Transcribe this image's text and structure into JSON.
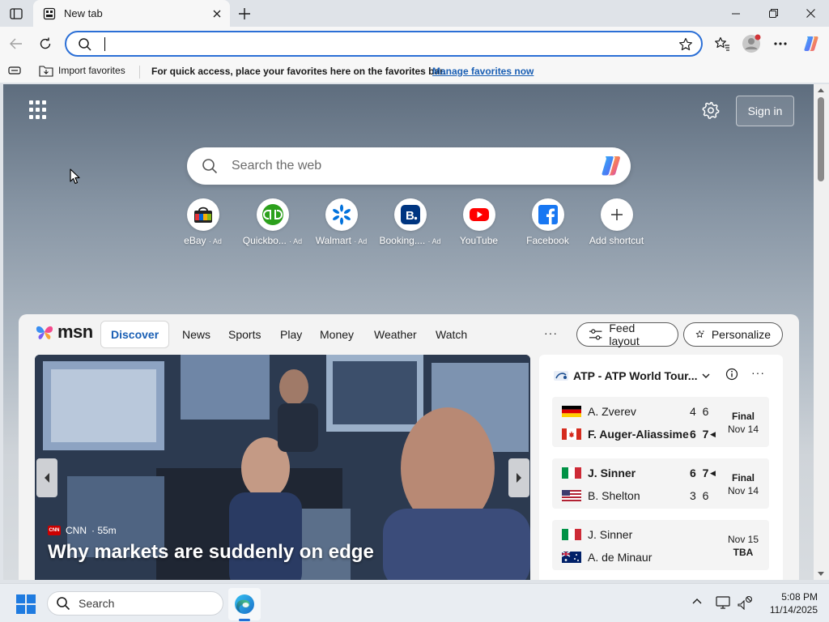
{
  "browser": {
    "tab_title": "New tab",
    "address_value": "",
    "favorites_bar": {
      "import_label": "Import favorites",
      "message": "For quick access, place your favorites here on the favorites bar.",
      "manage_link": "Manage favorites now"
    }
  },
  "newtab": {
    "signin_label": "Sign in",
    "search_placeholder": "Search the web",
    "shortcuts": [
      {
        "label": "eBay",
        "ad": "· Ad",
        "icon": "ebay-icon"
      },
      {
        "label": "Quickbo...",
        "ad": "· Ad",
        "icon": "quickbooks-icon"
      },
      {
        "label": "Walmart",
        "ad": "· Ad",
        "icon": "walmart-icon"
      },
      {
        "label": "Booking....",
        "ad": "· Ad",
        "icon": "booking-icon"
      },
      {
        "label": "YouTube",
        "ad": "",
        "icon": "youtube-icon"
      },
      {
        "label": "Facebook",
        "ad": "",
        "icon": "facebook-icon"
      },
      {
        "label": "Add shortcut",
        "ad": "",
        "icon": "plus-icon"
      }
    ]
  },
  "feed": {
    "logo_text": "msn",
    "nav": [
      "Discover",
      "News",
      "Sports",
      "Play",
      "Money",
      "Weather",
      "Watch"
    ],
    "more_label": "···",
    "feed_layout_label": "Feed layout",
    "personalize_label": "Personalize",
    "hero": {
      "source": "CNN",
      "time": "· 55m",
      "badge": "CNN",
      "title": "Why markets are suddenly on edge"
    },
    "sports": {
      "title": "ATP - ATP World Tour...",
      "matches": [
        {
          "p1": {
            "name": "A. Zverev",
            "score": "4 6",
            "win": false,
            "flag": "germany"
          },
          "p2": {
            "name": "F. Auger-Aliassime",
            "score": "6 7",
            "win": true,
            "flag": "canada"
          },
          "status": "Final",
          "date": "Nov 14"
        },
        {
          "p1": {
            "name": "J. Sinner",
            "score": "6 7",
            "win": true,
            "flag": "italy"
          },
          "p2": {
            "name": "B. Shelton",
            "score": "3 6",
            "win": false,
            "flag": "usa"
          },
          "status": "Final",
          "date": "Nov 14"
        },
        {
          "p1": {
            "name": "J. Sinner",
            "score": "",
            "win": false,
            "flag": "italy"
          },
          "p2": {
            "name": "A. de Minaur",
            "score": "",
            "win": false,
            "flag": "australia"
          },
          "status": "TBA",
          "date": "Nov 15"
        }
      ]
    }
  },
  "taskbar": {
    "search_label": "Search",
    "time": "5:08 PM",
    "date": "11/14/2025"
  },
  "colors": {
    "accent": "#2b6fd6",
    "link": "#1a5fb4",
    "cnn_red": "#cc0000"
  }
}
